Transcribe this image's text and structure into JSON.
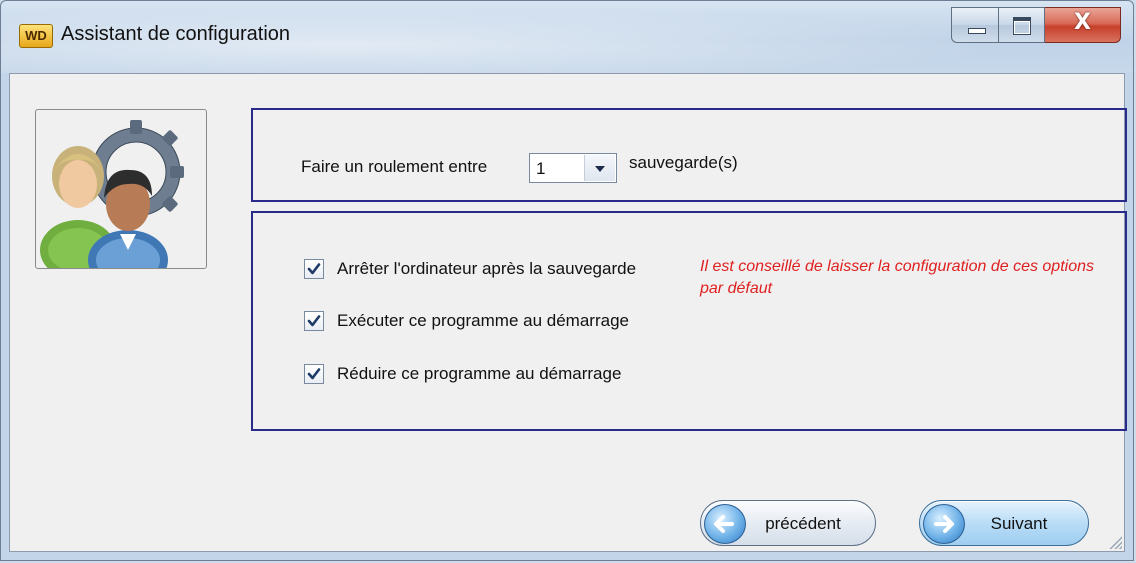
{
  "window": {
    "app_logo_text": "WD",
    "title": "Assistant de configuration",
    "controls": {
      "minimize_icon": "minimize-icon",
      "maximize_icon": "maximize-icon",
      "close_icon": "close-icon",
      "close_glyph": "X"
    }
  },
  "rotation": {
    "label_before": "Faire un roulement entre",
    "selected_value": "1",
    "label_after": "sauvegarde(s)"
  },
  "options": [
    {
      "label": "Arrêter l'ordinateur après la sauvegarde",
      "checked": true
    },
    {
      "label": "Exécuter ce programme au démarrage",
      "checked": true
    },
    {
      "label": "Réduire ce programme au démarrage",
      "checked": true
    }
  ],
  "hint": "Il est conseillé de laisser la configuration de ces options par défaut",
  "buttons": {
    "previous": "précédent",
    "next": "Suivant"
  },
  "icons": {
    "users": "users-gear-icon",
    "back": "arrow-left-icon",
    "forward": "arrow-right-icon"
  },
  "colors": {
    "panel_border": "#2a2a8a",
    "hint_text": "#e02020"
  }
}
